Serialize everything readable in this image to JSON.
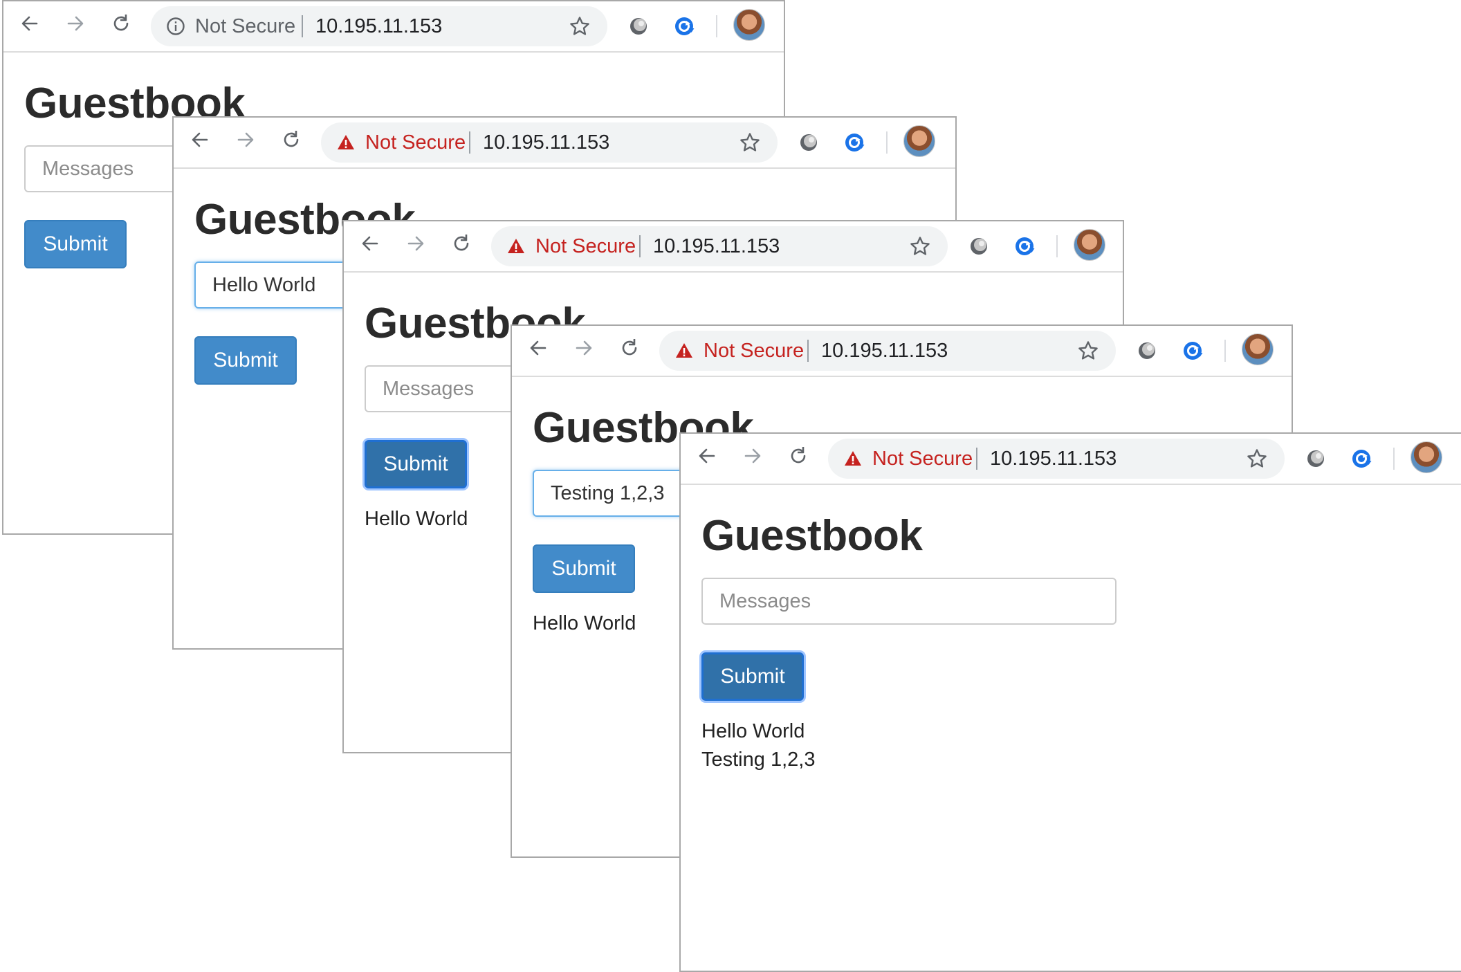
{
  "windows": [
    {
      "security_text": "Not Secure",
      "security_style": "info",
      "url": "10.195.11.153",
      "title": "Guestbook",
      "input_value": "",
      "input_placeholder": "Messages",
      "input_focused": false,
      "submit_label": "Submit",
      "submit_active": false,
      "messages": []
    },
    {
      "security_text": "Not Secure",
      "security_style": "warn",
      "url": "10.195.11.153",
      "title": "Guestbook",
      "input_value": "Hello World",
      "input_placeholder": "Messages",
      "input_focused": true,
      "submit_label": "Submit",
      "submit_active": false,
      "messages": []
    },
    {
      "security_text": "Not Secure",
      "security_style": "warn",
      "url": "10.195.11.153",
      "title": "Guestbook",
      "input_value": "",
      "input_placeholder": "Messages",
      "input_focused": false,
      "submit_label": "Submit",
      "submit_active": true,
      "messages": [
        "Hello World"
      ]
    },
    {
      "security_text": "Not Secure",
      "security_style": "warn",
      "url": "10.195.11.153",
      "title": "Guestbook",
      "input_value": "Testing 1,2,3",
      "input_placeholder": "Messages",
      "input_focused": true,
      "submit_label": "Submit",
      "submit_active": false,
      "messages": [
        "Hello World"
      ]
    },
    {
      "security_text": "Not Secure",
      "security_style": "warn",
      "url": "10.195.11.153",
      "title": "Guestbook",
      "input_value": "",
      "input_placeholder": "Messages",
      "input_focused": false,
      "submit_label": "Submit",
      "submit_active": true,
      "messages": [
        "Hello World",
        "Testing 1,2,3"
      ]
    }
  ],
  "icons": {
    "back": "arrow-left-icon",
    "forward": "arrow-right-icon",
    "reload": "reload-icon",
    "warning": "warning-triangle-icon",
    "info": "info-circle-icon",
    "bookmark": "star-icon",
    "extension1": "grey-orb-extension-icon",
    "extension2": "blue-refresh-extension-icon",
    "profile": "profile-avatar"
  },
  "colors": {
    "button": "#428bca",
    "button_active": "#3071a9",
    "warning_red": "#c5221f",
    "focus_blue": "#66afe9"
  }
}
